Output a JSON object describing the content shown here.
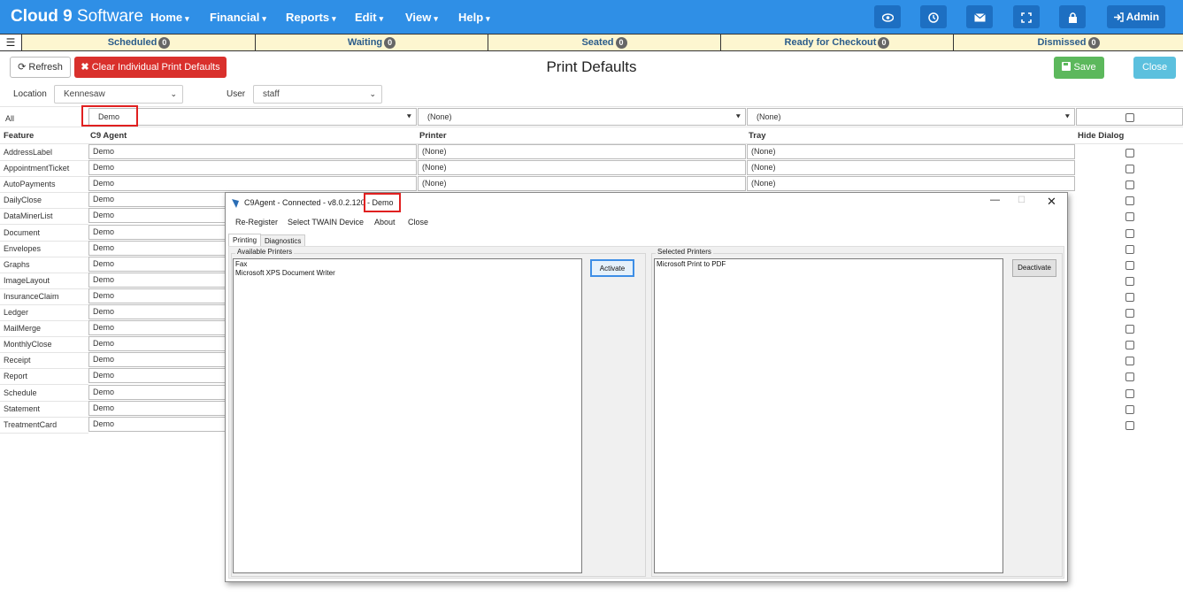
{
  "topbar": {
    "brand_bold": "Cloud 9",
    "brand_light": " Software",
    "nav": [
      "Home",
      "Financial",
      "Reports",
      "Edit",
      "View",
      "Help"
    ],
    "admin_label": "Admin",
    "icons": [
      "eye-icon",
      "clock-icon",
      "envelope-icon",
      "expand-icon",
      "lock-icon",
      "sign-out-icon"
    ]
  },
  "status_tabs": [
    {
      "label": "Scheduled",
      "count": "0"
    },
    {
      "label": "Waiting",
      "count": "0"
    },
    {
      "label": "Seated",
      "count": "0"
    },
    {
      "label": "Ready for Checkout",
      "count": "0"
    },
    {
      "label": "Dismissed",
      "count": "0"
    }
  ],
  "toolbar": {
    "refresh": "Refresh",
    "clear": "Clear Individual Print Defaults",
    "save": "Save",
    "close": "Close"
  },
  "page_title": "Print Defaults",
  "filters": {
    "location_label": "Location",
    "location_value": "Kennesaw",
    "user_label": "User",
    "user_value": "staff"
  },
  "grid": {
    "all_label": "All",
    "all_agent": "Demo",
    "all_printer": "(None)",
    "all_tray": "(None)",
    "headers": {
      "feature": "Feature",
      "agent": "C9 Agent",
      "printer": "Printer",
      "tray": "Tray",
      "hide": "Hide Dialog"
    },
    "rows": [
      {
        "feature": "AddressLabel",
        "agent": "Demo",
        "printer": "(None)",
        "tray": "(None)"
      },
      {
        "feature": "AppointmentTicket",
        "agent": "Demo",
        "printer": "(None)",
        "tray": "(None)"
      },
      {
        "feature": "AutoPayments",
        "agent": "Demo",
        "printer": "(None)",
        "tray": "(None)"
      },
      {
        "feature": "DailyClose",
        "agent": "Demo",
        "printer": "",
        "tray": ""
      },
      {
        "feature": "DataMinerList",
        "agent": "Demo",
        "printer": "",
        "tray": ""
      },
      {
        "feature": "Document",
        "agent": "Demo",
        "printer": "",
        "tray": ""
      },
      {
        "feature": "Envelopes",
        "agent": "Demo",
        "printer": "",
        "tray": ""
      },
      {
        "feature": "Graphs",
        "agent": "Demo",
        "printer": "",
        "tray": ""
      },
      {
        "feature": "ImageLayout",
        "agent": "Demo",
        "printer": "",
        "tray": ""
      },
      {
        "feature": "InsuranceClaim",
        "agent": "Demo",
        "printer": "",
        "tray": ""
      },
      {
        "feature": "Ledger",
        "agent": "Demo",
        "printer": "",
        "tray": ""
      },
      {
        "feature": "MailMerge",
        "agent": "Demo",
        "printer": "",
        "tray": ""
      },
      {
        "feature": "MonthlyClose",
        "agent": "Demo",
        "printer": "",
        "tray": ""
      },
      {
        "feature": "Receipt",
        "agent": "Demo",
        "printer": "",
        "tray": ""
      },
      {
        "feature": "Report",
        "agent": "Demo",
        "printer": "",
        "tray": ""
      },
      {
        "feature": "Schedule",
        "agent": "Demo",
        "printer": "",
        "tray": ""
      },
      {
        "feature": "Statement",
        "agent": "Demo",
        "printer": "",
        "tray": ""
      },
      {
        "feature": "TreatmentCard",
        "agent": "Demo",
        "printer": "",
        "tray": ""
      }
    ]
  },
  "dialog": {
    "title_main": "C9Agent - Connected  - v8.0.2.120",
    "title_suffix": "- Demo",
    "menu": [
      "Re-Register",
      "Select TWAIN Device",
      "About",
      "Close"
    ],
    "tabs": [
      "Printing",
      "Diagnostics"
    ],
    "available_label": "Available Printers",
    "available": [
      "Fax",
      "Microsoft XPS Document Writer"
    ],
    "activate": "Activate",
    "selected_label": "Selected Printers",
    "selected": [
      "Microsoft Print to PDF"
    ],
    "deactivate": "Deactivate"
  },
  "colors": {
    "topbar": "#2f8fe6",
    "status_bg": "#fdf6d0",
    "clear_btn": "#d9302c",
    "save_btn": "#5cb85c",
    "close_btn": "#5bc0de",
    "highlight": "#e02020"
  }
}
